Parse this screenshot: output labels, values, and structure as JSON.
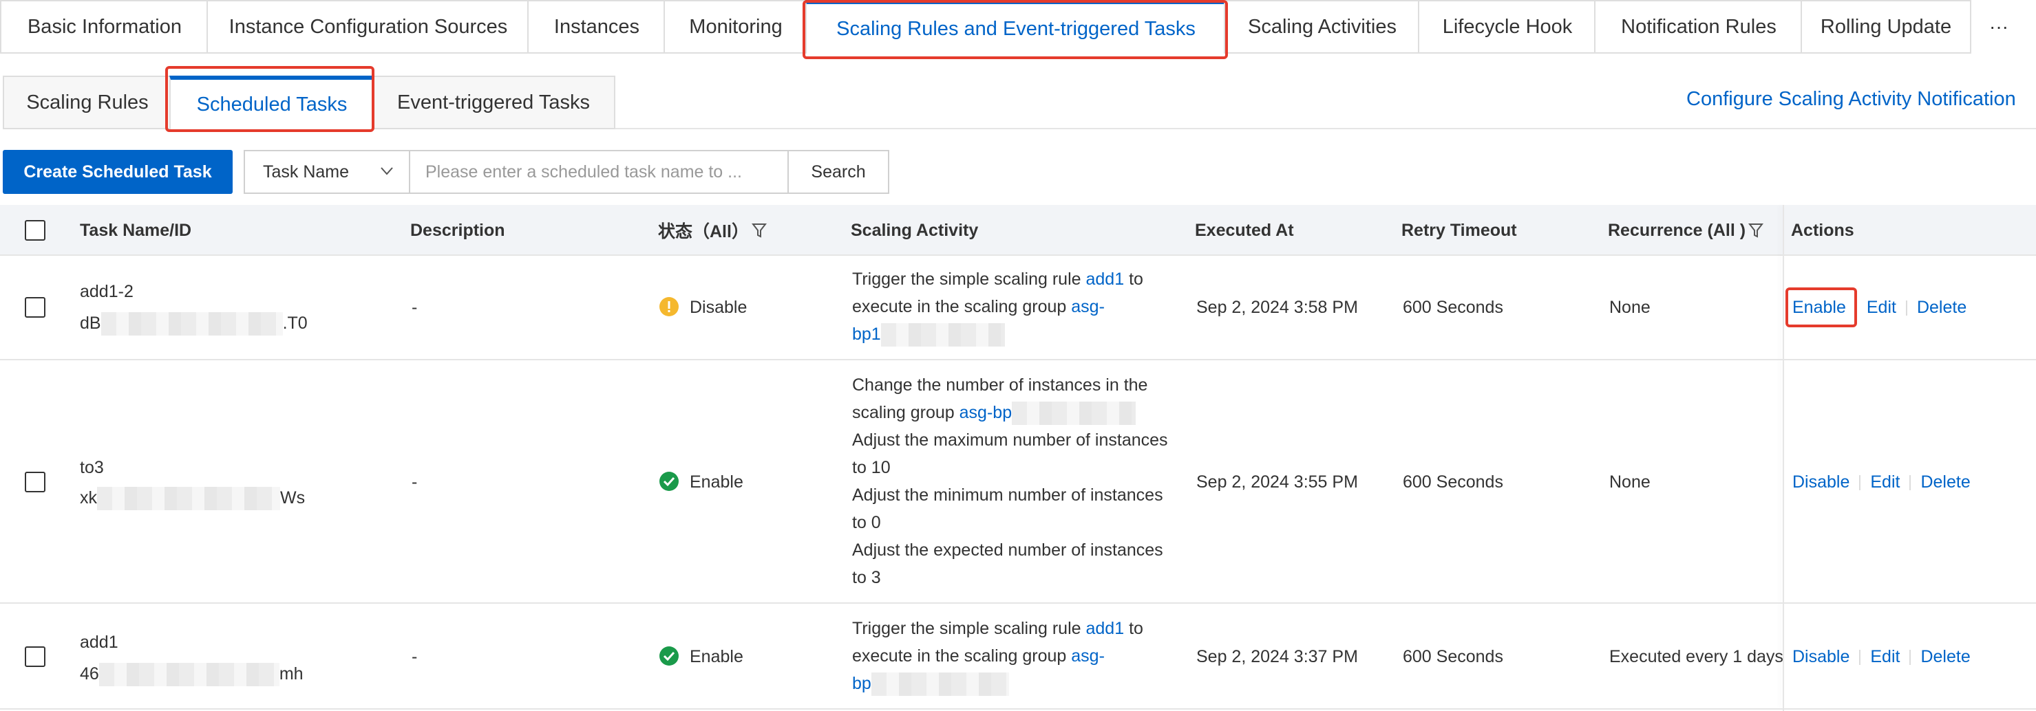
{
  "tabs": [
    {
      "label": "Basic Information"
    },
    {
      "label": "Instance Configuration Sources"
    },
    {
      "label": "Instances"
    },
    {
      "label": "Monitoring"
    },
    {
      "label": "Scaling Rules and Event-triggered Tasks",
      "active": true
    },
    {
      "label": "Scaling Activities"
    },
    {
      "label": "Lifecycle Hook"
    },
    {
      "label": "Notification Rules"
    },
    {
      "label": "Rolling Update"
    }
  ],
  "tabs_more": "···",
  "subtabs": [
    {
      "label": "Scaling Rules"
    },
    {
      "label": "Scheduled Tasks",
      "active": true
    },
    {
      "label": "Event-triggered Tasks"
    }
  ],
  "configure_link": "Configure Scaling Activity Notification",
  "toolbar": {
    "create_label": "Create Scheduled Task",
    "filter_select": "Task Name",
    "search_placeholder": "Please enter a scheduled task name to ...",
    "search_label": "Search"
  },
  "table": {
    "headers": {
      "name": "Task Name/ID",
      "description": "Description",
      "status": "状态（All）",
      "activity": "Scaling Activity",
      "executed": "Executed At",
      "retry": "Retry Timeout",
      "recurrence": "Recurrence (All )",
      "actions": "Actions"
    },
    "rows": [
      {
        "name": "add1-2",
        "id_prefix": "dB",
        "id_suffix": ".T0",
        "description": "-",
        "status": "Disable",
        "activity_lines": [
          "Trigger the simple scaling rule ",
          "add1",
          " to",
          "execute in the scaling group ",
          "asg-",
          "bp1"
        ],
        "executed": "Sep 2, 2024 3:58 PM",
        "retry": "600 Seconds",
        "recurrence": "None",
        "action_toggle": "Enable",
        "action_edit": "Edit",
        "action_delete": "Delete"
      },
      {
        "name": "to3",
        "id_prefix": "xk",
        "id_suffix": "Ws",
        "description": "-",
        "status": "Enable",
        "activity_lines": [
          "Change the number of instances in the",
          "scaling group ",
          "asg-bp",
          "Adjust the maximum number of instances",
          "to 10",
          "Adjust the minimum number of instances",
          "to 0",
          "Adjust the expected number of instances",
          "to 3"
        ],
        "executed": "Sep 2, 2024 3:55 PM",
        "retry": "600 Seconds",
        "recurrence": "None",
        "action_toggle": "Disable",
        "action_edit": "Edit",
        "action_delete": "Delete"
      },
      {
        "name": "add1",
        "id_prefix": "46",
        "id_suffix": "mh",
        "description": "-",
        "status": "Enable",
        "activity_lines": [
          "Trigger the simple scaling rule ",
          "add1",
          " to",
          "execute in the scaling group ",
          "asg-",
          "bp"
        ],
        "executed": "Sep 2, 2024 3:37 PM",
        "retry": "600 Seconds",
        "recurrence": "Executed every 1 days",
        "action_toggle": "Disable",
        "action_edit": "Edit",
        "action_delete": "Delete"
      }
    ]
  },
  "colors": {
    "accent": "#0064c8",
    "highlight": "#e53b2c",
    "warning": "#f5b82e",
    "success": "#1a9a4a"
  }
}
